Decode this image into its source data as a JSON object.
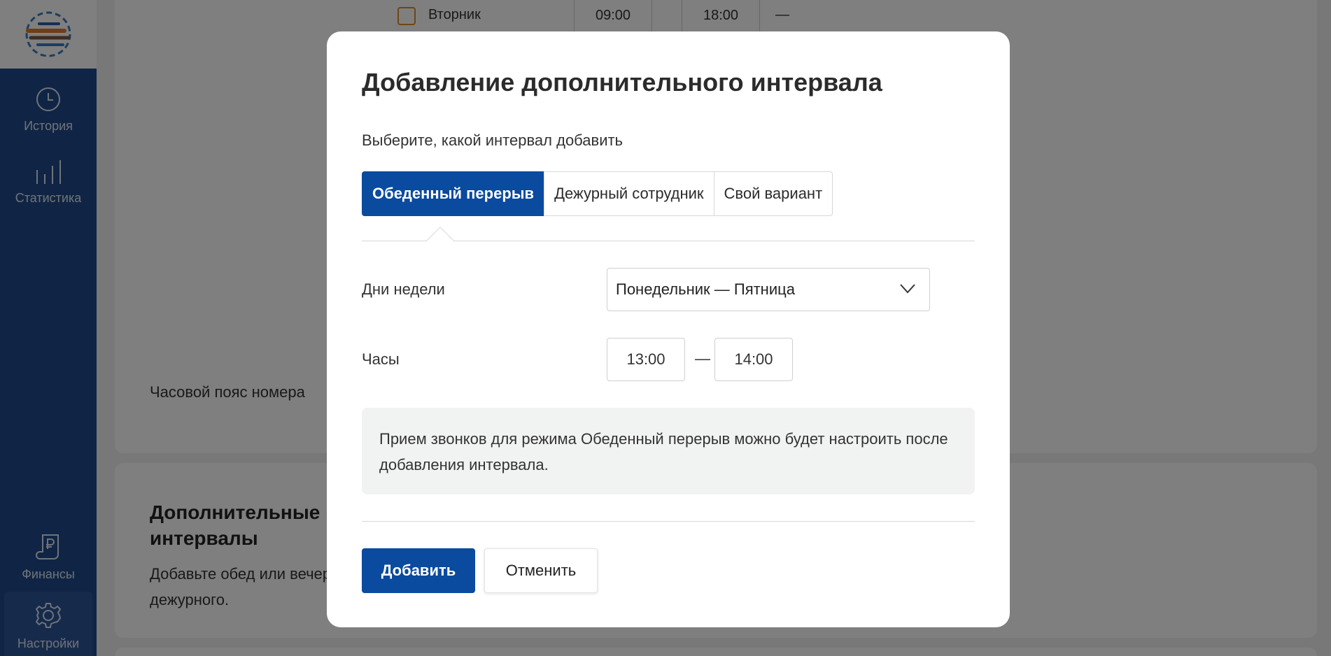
{
  "sidebar": {
    "items": [
      {
        "label": "История",
        "icon": "clock-icon"
      },
      {
        "label": "Статистика",
        "icon": "bar-chart-icon"
      },
      {
        "label": "Финансы",
        "icon": "ruble-document-icon"
      },
      {
        "label": "Настройки",
        "icon": "gear-icon",
        "active": true
      }
    ]
  },
  "background": {
    "day_label": "Вторник",
    "time_from": "09:00",
    "time_to": "18:00",
    "timezone_label": "Часовой пояс номера",
    "extra_title": "Дополнительные интервалы",
    "extra_desc": "Добавьте обед или вечерне дежурного."
  },
  "modal": {
    "title": "Добавление дополнительного интервала",
    "subtitle": "Выберите, какой интервал добавить",
    "tabs": [
      {
        "label": "Обеденный перерыв",
        "active": true
      },
      {
        "label": "Дежурный сотрудник",
        "active": false
      },
      {
        "label": "Свой вариант",
        "active": false
      }
    ],
    "days_label": "Дни недели",
    "days_value": "Понедельник — Пятница",
    "hours_label": "Часы",
    "hours_from": "13:00",
    "hours_dash": "—",
    "hours_to": "14:00",
    "info_text": "Прием звонков для режима Обеденный перерыв можно будет настроить после добавления интервала.",
    "add_button": "Добавить",
    "cancel_button": "Отменить"
  },
  "colors": {
    "sidebar": "#214a8a",
    "primary": "#0a4a9f",
    "accent_orange": "#e08a2c"
  }
}
